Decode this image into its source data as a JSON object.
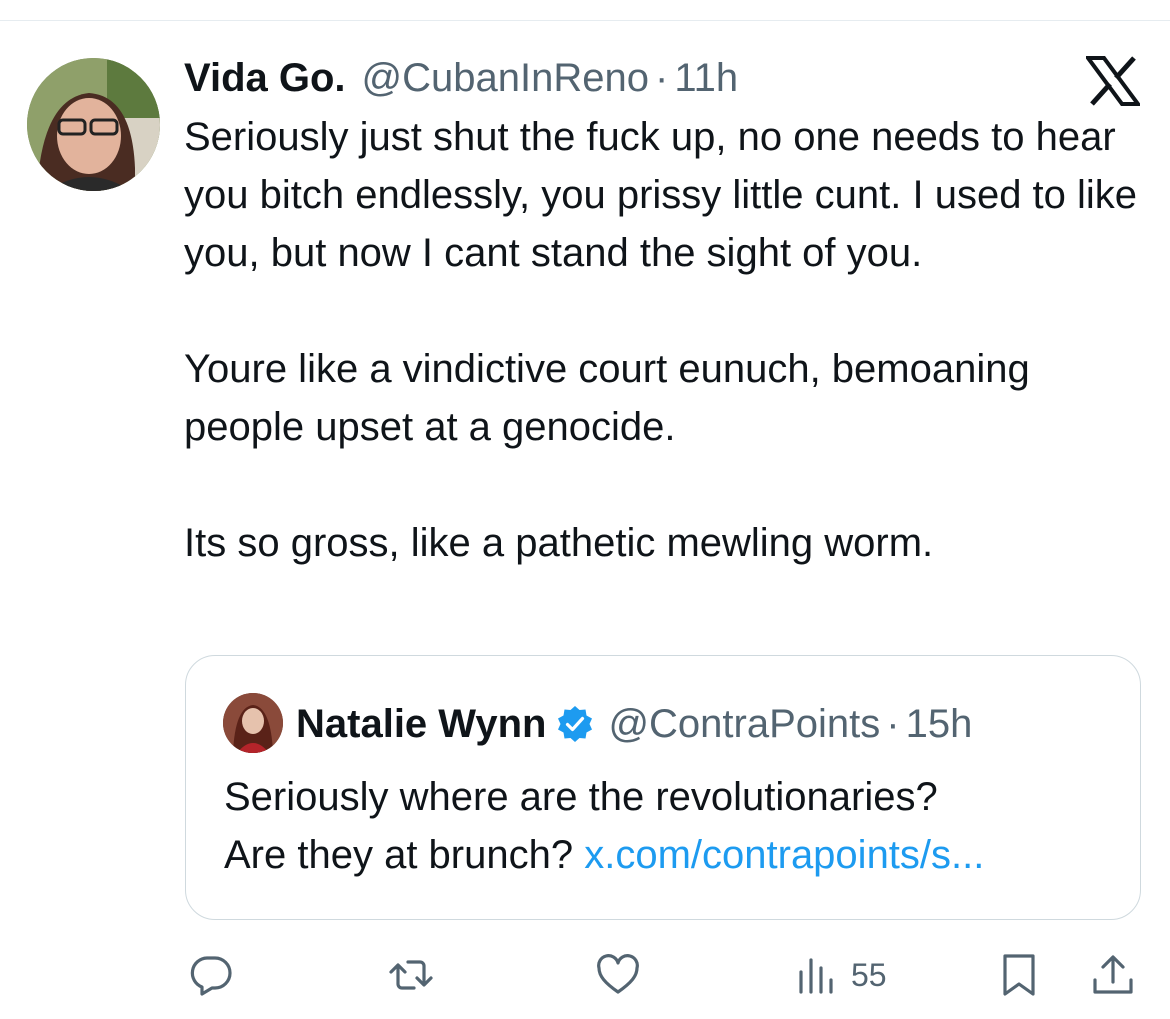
{
  "tweet": {
    "author_name": "Vida Go.",
    "author_handle": "@CubanInReno",
    "separator": "·",
    "time": "11h",
    "paragraphs": [
      "Seriously just shut the fuck up, no one needs to hear you bitch endlessly, you prissy little cunt. I used to like you, but now I cant stand the sight of you.",
      "Youre like a vindictive court eunuch, bemoaning people upset at a genocide.",
      "Its so gross, like a pathetic mewling worm."
    ],
    "avatar_icon": "profile-photo",
    "platform_icon": "x-logo-icon"
  },
  "quote": {
    "author_name": "Natalie Wynn",
    "verified_icon": "verified-badge-icon",
    "author_handle": "@ContraPoints",
    "separator": "·",
    "time": "15h",
    "text_line1": "Seriously where are the revolutionaries?",
    "text_line2_prefix": "Are they at brunch? ",
    "link_text": "x.com/contrapoints/s..."
  },
  "actions": {
    "reply_icon": "reply-icon",
    "retweet_icon": "retweet-icon",
    "like_icon": "heart-icon",
    "views_icon": "views-icon",
    "views_count": "55",
    "bookmark_icon": "bookmark-icon",
    "share_icon": "share-icon"
  },
  "colors": {
    "text": "#0f1419",
    "secondary": "#536471",
    "link": "#1d9bf0",
    "border": "#cfd9de"
  }
}
